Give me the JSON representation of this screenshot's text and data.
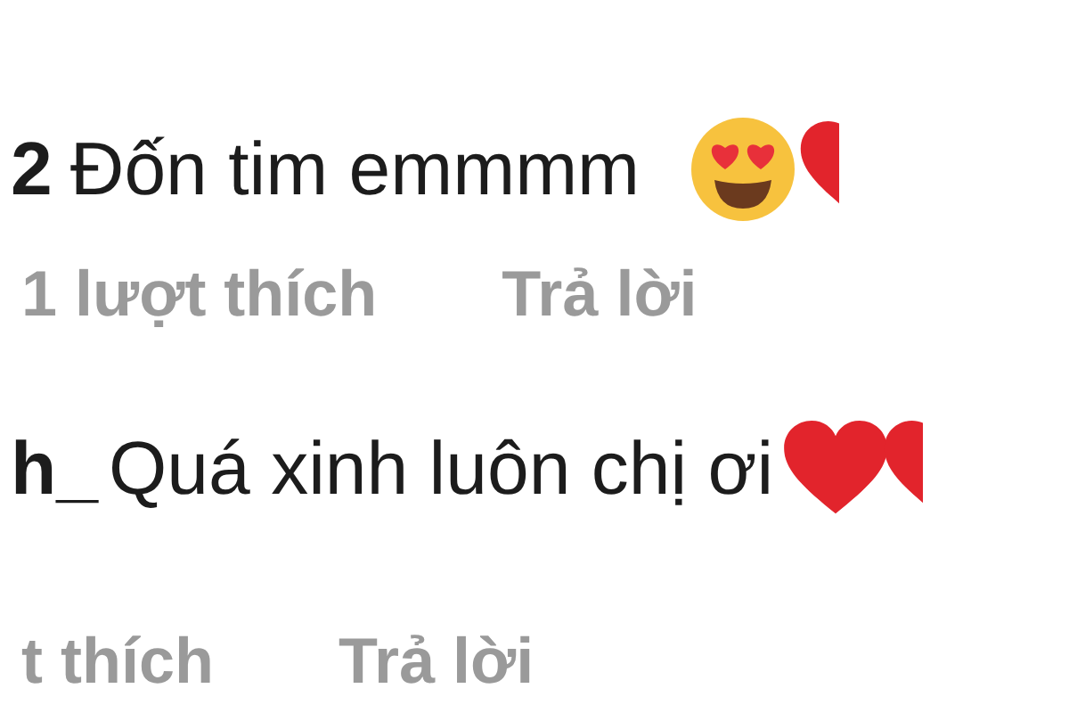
{
  "comments": [
    {
      "username": "2",
      "text": "Đốn tim emmmm",
      "emojis": [
        {
          "kind": "heart-eyes"
        },
        {
          "kind": "heart-cut"
        }
      ],
      "likes": "1 lượt thích",
      "reply": "Trả lời"
    },
    {
      "username": "h_",
      "text": "Quá xinh luôn chị ơi",
      "emojis": [
        {
          "kind": "heart"
        },
        {
          "kind": "heart-cut"
        }
      ],
      "likes": "t thích",
      "reply": "Trả lời"
    }
  ]
}
